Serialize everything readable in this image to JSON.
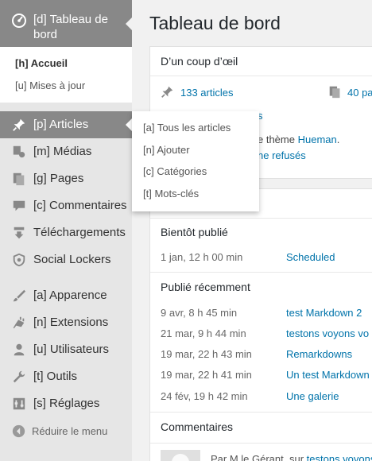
{
  "sidebar": {
    "current": {
      "label": "[d] Tableau de bord",
      "icon": "dashboard-icon"
    },
    "submenu": [
      {
        "label": "[h] Accueil",
        "active": true
      },
      {
        "label": "[u] Mises à jour",
        "active": false
      }
    ],
    "items": [
      {
        "label": "[p] Articles",
        "icon": "pushpin-icon"
      },
      {
        "label": "[m] Médias",
        "icon": "media-icon"
      },
      {
        "label": "[g] Pages",
        "icon": "pages-icon"
      },
      {
        "label": "[c] Commentaires",
        "icon": "comment-icon"
      },
      {
        "label": "Téléchargements",
        "icon": "download-icon"
      },
      {
        "label": "Social Lockers",
        "icon": "shield-icon"
      },
      {
        "label": "[a] Apparence",
        "icon": "brush-icon"
      },
      {
        "label": "[n] Extensions",
        "icon": "plugin-icon"
      },
      {
        "label": "[u] Utilisateurs",
        "icon": "user-icon"
      },
      {
        "label": "[t] Outils",
        "icon": "wrench-icon"
      },
      {
        "label": "[s] Réglages",
        "icon": "settings-icon"
      }
    ],
    "collapse": {
      "label": "Réduire le menu",
      "icon": "collapse-icon"
    }
  },
  "flyout": {
    "items": [
      "[a] Tous les articles",
      "[n] Ajouter",
      "[c] Catégories",
      "[t] Mots-clés"
    ]
  },
  "main": {
    "title": "Tableau de bord",
    "glance": {
      "title": "D’un coup d’œil",
      "articles": "133 articles",
      "pages": "40 pa",
      "partial_link": "s",
      "theme_text": "e thème ",
      "theme_link": "Hueman",
      "theme_after": ".",
      "refused": "ne refusés"
    },
    "activity": {
      "scheduled_heading": "Bientôt publié",
      "scheduled": [
        {
          "date": "1 jan, 12 h 00 min",
          "title": "Scheduled"
        }
      ],
      "recent_heading": "Publié récemment",
      "recent": [
        {
          "date": "9 avr, 8 h 45 min",
          "title": "test Markdown 2"
        },
        {
          "date": "21 mar, 9 h 44 min",
          "title": "testons voyons vo"
        },
        {
          "date": "19 mar, 22 h 43 min",
          "title": "Remarkdowns"
        },
        {
          "date": "19 mar, 22 h 41 min",
          "title": "Un test Markdown"
        },
        {
          "date": "24 fév, 19 h 42 min",
          "title": "Une galerie"
        }
      ],
      "comments_heading": "Commentaires",
      "comment_by": "Par M le Gérant, sur ",
      "comment_link": "testons voyons"
    }
  },
  "colors": {
    "sidebar_bg": "#e6e6e6",
    "sidebar_active": "#888888",
    "link": "#0073aa",
    "page_bg": "#f1f1f1"
  }
}
